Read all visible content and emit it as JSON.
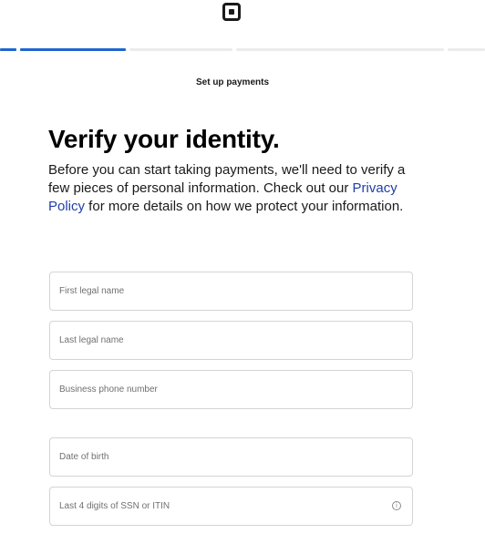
{
  "header": {
    "logo_icon": "square-logo-icon",
    "step_label": "Set up payments",
    "progress_segments": [
      {
        "status": "complete",
        "color": "#1f66d1"
      },
      {
        "status": "complete",
        "color": "#1f66d1"
      },
      {
        "status": "incomplete",
        "color": "#ececec"
      },
      {
        "status": "incomplete",
        "color": "#ececec"
      },
      {
        "status": "incomplete",
        "color": "#ececec"
      }
    ]
  },
  "main": {
    "title": "Verify your identity.",
    "intro_before_link": "Before you can start taking payments, we'll need to verify a few pieces of personal information. Check out our ",
    "privacy_link": "Privacy Policy",
    "intro_after_link": " for more details on how we protect your information."
  },
  "form": {
    "first_name": {
      "placeholder": "First legal name",
      "value": ""
    },
    "last_name": {
      "placeholder": "Last legal name",
      "value": ""
    },
    "phone": {
      "placeholder": "Business phone number",
      "value": ""
    },
    "dob": {
      "placeholder": "Date of birth",
      "value": ""
    },
    "ssn": {
      "placeholder": "Last 4 digits of SSN or ITIN",
      "value": "",
      "icon": "info-icon"
    }
  },
  "colors": {
    "accent": "#1f66d1",
    "link": "#1f3fa8",
    "border": "#d4d4d4"
  }
}
